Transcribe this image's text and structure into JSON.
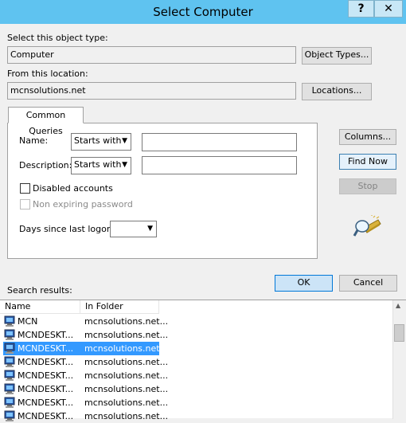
{
  "window": {
    "title": "Select Computer",
    "help_glyph": "?",
    "close_glyph": "✕"
  },
  "object_type": {
    "label": "Select this object type:",
    "value": "Computer",
    "button": "Object Types..."
  },
  "location": {
    "label": "From this location:",
    "value": "mcnsolutions.net",
    "button": "Locations..."
  },
  "queries": {
    "tab": "Common Queries",
    "name_label": "Name:",
    "name_mode": "Starts with",
    "name_value": "",
    "description_label": "Description:",
    "description_mode": "Starts with",
    "description_value": "",
    "disabled_accounts": "Disabled accounts",
    "non_expiring_password": "Non expiring password",
    "days_label": "Days since last logon:",
    "days_value": ""
  },
  "side_buttons": {
    "columns": "Columns...",
    "find_now": "Find Now",
    "stop": "Stop"
  },
  "dialog_buttons": {
    "ok": "OK",
    "cancel": "Cancel"
  },
  "results": {
    "label": "Search results:",
    "columns": [
      "Name",
      "In Folder"
    ],
    "rows": [
      {
        "name": "MCN",
        "folder": "mcnsolutions.net...",
        "selected": false
      },
      {
        "name": "MCNDESKT...",
        "folder": "mcnsolutions.net...",
        "selected": false
      },
      {
        "name": "MCNDESKT...",
        "folder": "mcnsolutions.net...",
        "selected": true
      },
      {
        "name": "MCNDESKT...",
        "folder": "mcnsolutions.net...",
        "selected": false
      },
      {
        "name": "MCNDESKT...",
        "folder": "mcnsolutions.net...",
        "selected": false
      },
      {
        "name": "MCNDESKT...",
        "folder": "mcnsolutions.net...",
        "selected": false
      },
      {
        "name": "MCNDESKT...",
        "folder": "mcnsolutions.net...",
        "selected": false
      },
      {
        "name": "MCNDESKT...",
        "folder": "mcnsolutions.net...",
        "selected": false
      }
    ]
  },
  "colors": {
    "titlebar": "#5fc3f0",
    "selection": "#3399ff"
  }
}
